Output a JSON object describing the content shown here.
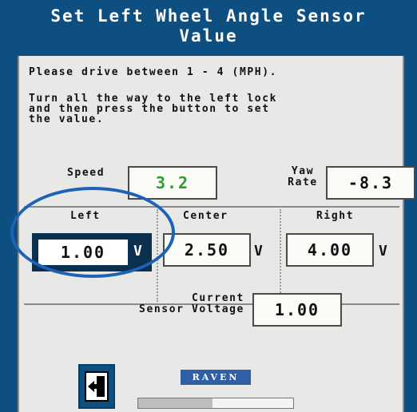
{
  "header": {
    "title_line1": "Set Left Wheel Angle Sensor",
    "title_line2": "Value"
  },
  "instructions": {
    "line1": "Please drive between 1 - 4 (MPH).",
    "line2": "Turn all the way to the left lock",
    "line3": "and then press the button to set",
    "line4": "the value."
  },
  "speed": {
    "label": "Speed",
    "value": "3.2",
    "color": "#2aa02a"
  },
  "yaw": {
    "label_line1": "Yaw",
    "label_line2": "Rate",
    "value": "-8.3"
  },
  "columns": {
    "left": {
      "label": "Left",
      "value": "1.00",
      "unit": "V"
    },
    "center": {
      "label": "Center",
      "value": "2.50",
      "unit": "V"
    },
    "right": {
      "label": "Right",
      "value": "4.00",
      "unit": "V"
    }
  },
  "current_voltage": {
    "label_line1": "Current",
    "label_line2": "Sensor Voltage",
    "value": "1.00"
  },
  "buttons": {
    "set_value_icon": "set-value-icon"
  },
  "logo": {
    "text": "RAVEN"
  },
  "progress": {
    "fraction": 0.48
  },
  "colors": {
    "header_bg": "#0d4f80",
    "highlight_oval": "#1e62b8",
    "speed_value": "#2aa02a"
  }
}
